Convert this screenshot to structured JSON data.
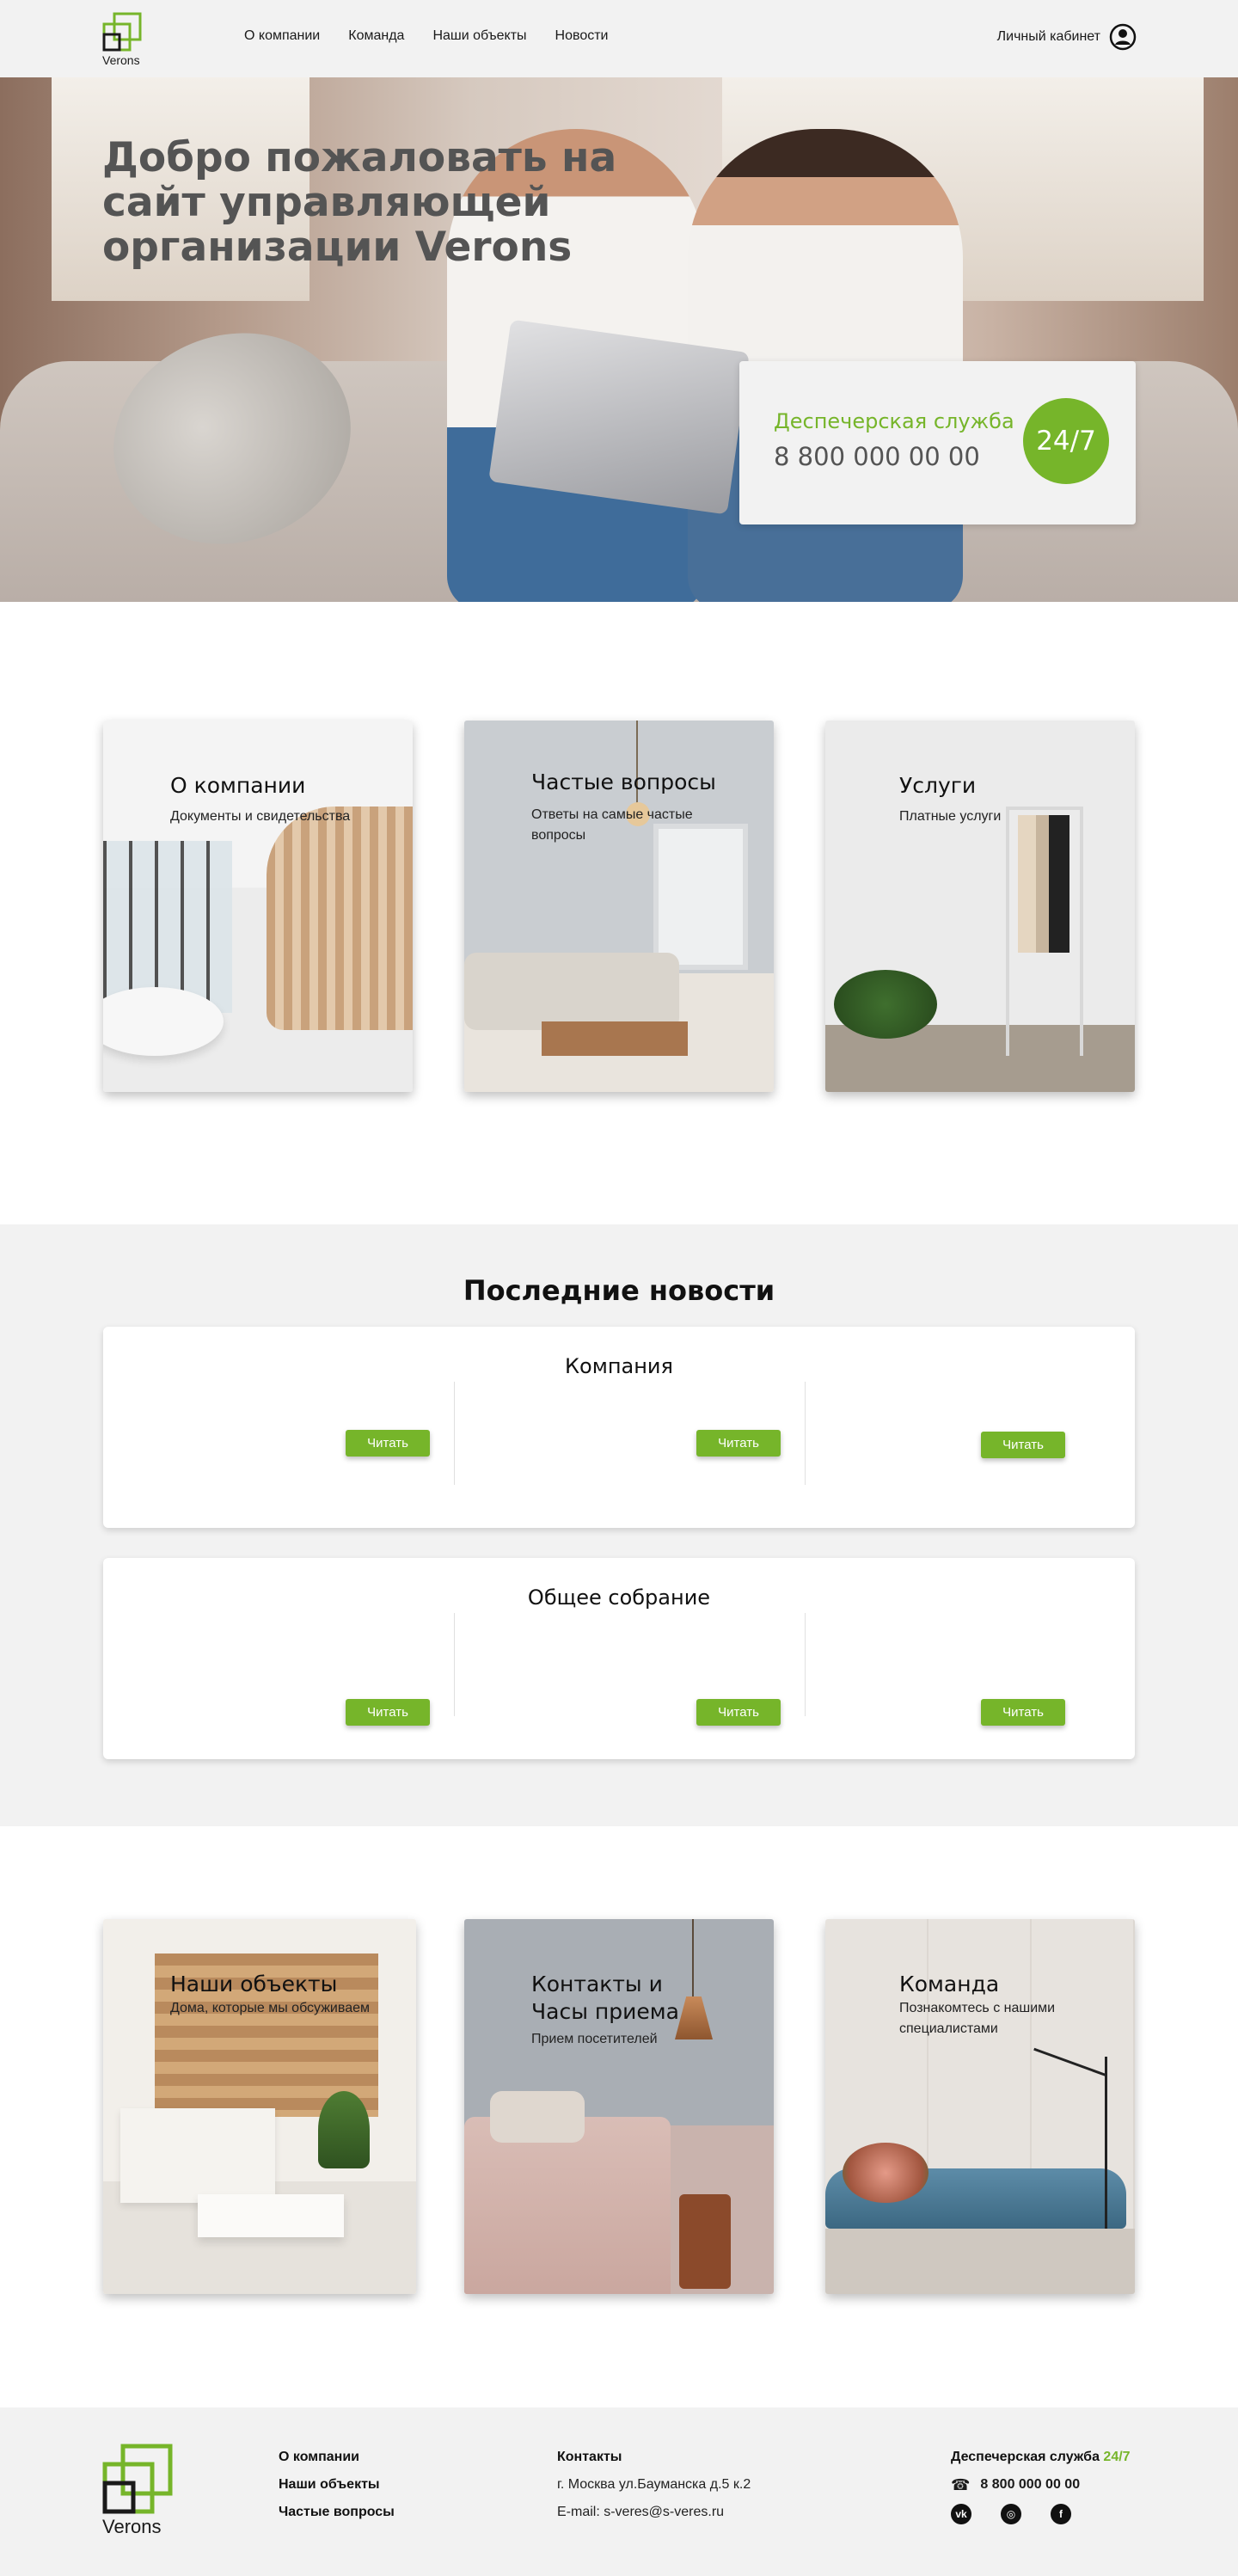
{
  "header": {
    "logo_text": "Verons",
    "nav": [
      "О компании",
      "Команда",
      "Наши объекты",
      "Новости"
    ],
    "cabinet_label": "Личный кабинет",
    "cabinet_icon": "user-circle-icon"
  },
  "hero": {
    "title": "Добро пожаловать на сайт управляющей организации Verons",
    "dispatch_label": "Деспечерская служба",
    "dispatch_phone": "8 800 000 00 00",
    "dispatch_badge": "24/7"
  },
  "cards_top": [
    {
      "title": "О  компании",
      "subtitle": "Документы и свидетельства"
    },
    {
      "title": "Частые вопросы",
      "subtitle": "Ответы на самые частые вопросы"
    },
    {
      "title": "Услуги",
      "subtitle": "Платные услуги"
    }
  ],
  "news": {
    "heading": "Последние новости",
    "blocks": [
      {
        "title": "Компания",
        "buttons": [
          "Читать",
          "Читать",
          "Читать"
        ]
      },
      {
        "title": "Общее собрание",
        "buttons": [
          "Читать",
          "Читать",
          "Читать"
        ]
      }
    ]
  },
  "cards_bottom": [
    {
      "title": "Наши  объекты",
      "subtitle": "Дома, которые мы обсуживаем"
    },
    {
      "title": "Контакты и\nЧасы приема",
      "subtitle": "Прием посетителей"
    },
    {
      "title": "Команда",
      "subtitle": "Познакомтесь с нашими специалистами"
    }
  ],
  "footer": {
    "logo_text": "Verons",
    "links": [
      "О компании",
      "Наши объекты",
      "Частые вопросы"
    ],
    "contacts_head": "Контакты",
    "address": "г. Москва ул.Бауманска д.5 к.2",
    "email": "E-mail: s-veres@s-veres.ru",
    "dispatch_label": "Деспечерская служба",
    "dispatch_badge": "24/7",
    "phone": "8 800 000 00 00",
    "phone_icon": "phone-icon",
    "social": [
      {
        "icon": "vk-icon",
        "glyph": "vk"
      },
      {
        "icon": "instagram-icon",
        "glyph": "◎"
      },
      {
        "icon": "facebook-icon",
        "glyph": "f"
      }
    ]
  },
  "colors": {
    "accent": "#76b52a",
    "header_bg": "#f2f2f2",
    "text_dark": "#545454"
  }
}
